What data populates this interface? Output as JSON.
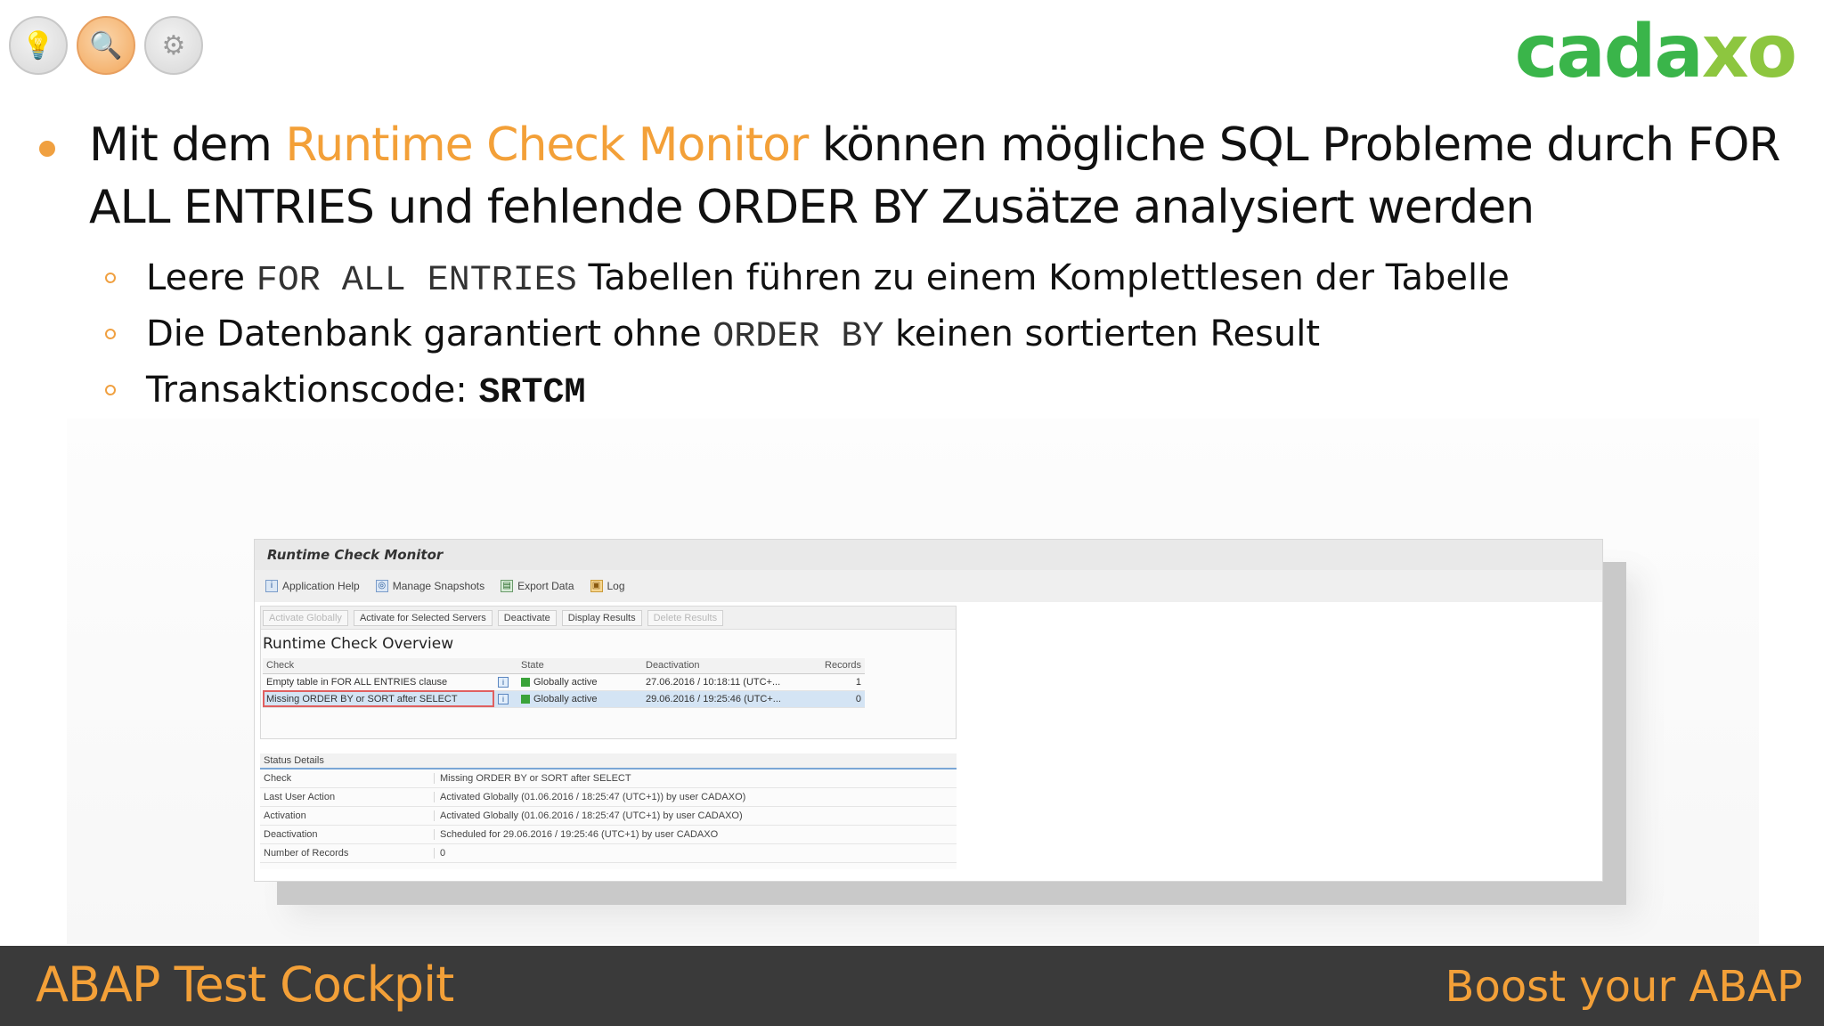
{
  "logo": {
    "main": "cada",
    "accent": "xo"
  },
  "icons": [
    {
      "name": "lightbulb-icon",
      "glyph": "💡"
    },
    {
      "name": "search-icon",
      "glyph": "🔍"
    },
    {
      "name": "puzzle-icon",
      "glyph": "⚙"
    }
  ],
  "heading": {
    "prefix": "Mit dem ",
    "highlight": "Runtime Check Monitor",
    "suffix": " können mögliche SQL Probleme durch FOR ALL ENTRIES und fehlende ORDER BY Zusätze analysiert werden"
  },
  "bullets": {
    "b1_pre": "Leere ",
    "b1_code": "FOR ALL ENTRIES",
    "b1_post": " Tabellen führen zu einem Komplettlesen der Tabelle",
    "b2_pre": "Die Datenbank garantiert ohne ",
    "b2_code": "ORDER BY",
    "b2_post": " keinen sortierten Result",
    "b3_pre": "Transaktionscode: ",
    "b3_code": "SRTCM"
  },
  "screenshot": {
    "title": "Runtime Check Monitor",
    "toolbar": {
      "help": "Application Help",
      "snapshots": "Manage Snapshots",
      "export": "Export Data",
      "log": "Log"
    },
    "buttons": {
      "activate_globally": "Activate Globally",
      "activate_selected": "Activate for Selected Servers",
      "deactivate": "Deactivate",
      "display_results": "Display Results",
      "delete_results": "Delete Results"
    },
    "overview_title": "Runtime Check Overview",
    "columns": {
      "check": "Check",
      "state": "State",
      "deactivation": "Deactivation",
      "records": "Records"
    },
    "rows": [
      {
        "check": "Empty table in FOR ALL ENTRIES clause",
        "state": "Globally active",
        "deactivation": "27.06.2016 / 10:18:11 (UTC+...",
        "records": "1"
      },
      {
        "check": "Missing ORDER BY or SORT after SELECT",
        "state": "Globally active",
        "deactivation": "29.06.2016 / 19:25:46 (UTC+...",
        "records": "0"
      }
    ],
    "details": {
      "header": "Status Details",
      "check_k": "Check",
      "check_v": "Missing ORDER BY or SORT after SELECT",
      "last_k": "Last User Action",
      "last_v": "Activated Globally (01.06.2016 / 18:25:47 (UTC+1)) by user CADAXO)",
      "act_k": "Activation",
      "act_v": "Activated Globally (01.06.2016 / 18:25:47 (UTC+1) by user CADAXO)",
      "deact_k": "Deactivation",
      "deact_v": "Scheduled for 29.06.2016 / 19:25:46 (UTC+1) by user CADAXO",
      "num_k": "Number of Records",
      "num_v": "0"
    }
  },
  "footer": {
    "left": "ABAP Test Cockpit",
    "right": "Boost your ABAP"
  },
  "colors": {
    "accent": "#f3a038",
    "logo_green": "#3ab54a",
    "footer_bg": "#3a3a3a"
  }
}
